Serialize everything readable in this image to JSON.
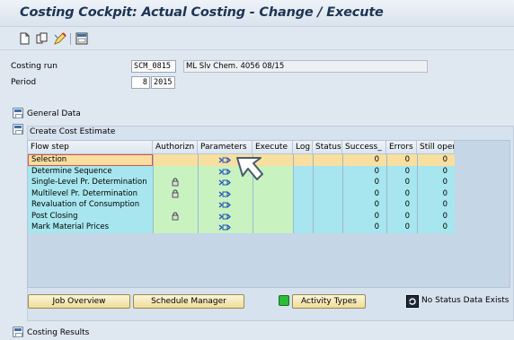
{
  "window": {
    "title": "Costing Cockpit: Actual Costing - Change / Execute"
  },
  "toolbar": {
    "icons": [
      "new-document-icon",
      "copy-icon",
      "edit-icon",
      "layout-icon"
    ]
  },
  "fields": {
    "costing_run_label": "Costing run",
    "costing_run_value": "SCM_0815",
    "costing_run_desc": "ML Slv Chem. 4056 08/15",
    "period_label": "Period",
    "period_value": "8",
    "period_year": "2015"
  },
  "sections": {
    "general_data": "General Data",
    "create_cost_estimate": "Create Cost Estimate",
    "costing_results": "Costing Results"
  },
  "table": {
    "headers": [
      "Flow step",
      "Authorizn",
      "Parameters",
      "Execute",
      "Log",
      "Status",
      "Success_",
      "Errors",
      "Still open"
    ],
    "rows": [
      {
        "step": "Selection",
        "lock": false,
        "success": "0",
        "errors": "0",
        "open": "0",
        "selected": true
      },
      {
        "step": "Determine Sequence",
        "lock": false,
        "success": "0",
        "errors": "0",
        "open": "0",
        "selected": false
      },
      {
        "step": "Single-Level Pr. Determination",
        "lock": true,
        "success": "0",
        "errors": "0",
        "open": "0",
        "selected": false
      },
      {
        "step": "Multilevel Pr. Determination",
        "lock": true,
        "success": "0",
        "errors": "0",
        "open": "0",
        "selected": false
      },
      {
        "step": "Revaluation of Consumption",
        "lock": false,
        "success": "0",
        "errors": "0",
        "open": "0",
        "selected": false
      },
      {
        "step": "Post Closing",
        "lock": true,
        "success": "0",
        "errors": "0",
        "open": "0",
        "selected": false
      },
      {
        "step": "Mark Material Prices",
        "lock": false,
        "success": "0",
        "errors": "0",
        "open": "0",
        "selected": false
      }
    ]
  },
  "buttons": {
    "job_overview": "Job Overview",
    "schedule_manager": "Schedule Manager",
    "activity_types": "Activity Types",
    "status_text": "No Status Data Exists"
  }
}
